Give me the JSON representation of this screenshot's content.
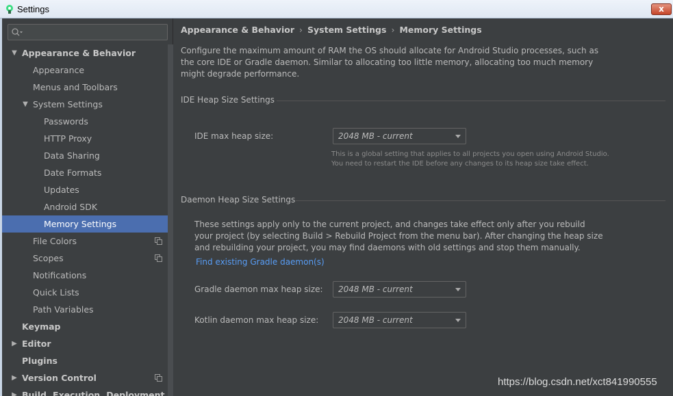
{
  "window": {
    "title": "Settings",
    "close_glyph": "x"
  },
  "search": {
    "placeholder": "",
    "icon": "search-icon"
  },
  "sidebar": {
    "items": [
      {
        "label": "Appearance & Behavior",
        "arrow": "▼"
      },
      {
        "label": "Appearance"
      },
      {
        "label": "Menus and Toolbars"
      },
      {
        "label": "System Settings",
        "arrow": "▼"
      },
      {
        "label": "Passwords"
      },
      {
        "label": "HTTP Proxy"
      },
      {
        "label": "Data Sharing"
      },
      {
        "label": "Date Formats"
      },
      {
        "label": "Updates"
      },
      {
        "label": "Android SDK"
      },
      {
        "label": "Memory Settings",
        "selected": true
      },
      {
        "label": "File Colors",
        "project_icon": true
      },
      {
        "label": "Scopes",
        "project_icon": true
      },
      {
        "label": "Notifications"
      },
      {
        "label": "Quick Lists"
      },
      {
        "label": "Path Variables"
      },
      {
        "label": "Keymap"
      },
      {
        "label": "Editor",
        "arrow": "▶"
      },
      {
        "label": "Plugins"
      },
      {
        "label": "Version Control",
        "arrow": "▶",
        "project_icon": true
      },
      {
        "label": "Build, Execution, Deployment",
        "arrow": "▶"
      }
    ]
  },
  "breadcrumb": {
    "items": [
      "Appearance & Behavior",
      "System Settings",
      "Memory Settings"
    ],
    "separator": "›"
  },
  "description": "Configure the maximum amount of RAM the OS should allocate for Android Studio processes, such as the core IDE or Gradle daemon. Similar to allocating too little memory, allocating too much memory might degrade performance.",
  "ide_section": {
    "title": "IDE Heap Size Settings",
    "label": "IDE max heap size:",
    "value": "2048 MB - current",
    "note_line1": "This is a global setting that applies to all projects you open using Android Studio.",
    "note_line2": "You need to restart the IDE before any changes to its heap size take effect."
  },
  "daemon_section": {
    "title": "Daemon Heap Size Settings",
    "description": "These settings apply only to the current project, and changes take effect only after you rebuild your project (by selecting Build > Rebuild Project from the menu bar). After changing the heap size and rebuilding your project, you may find daemons with old settings and stop them manually.",
    "link": "Find existing Gradle daemon(s)",
    "gradle_label": "Gradle daemon max heap size:",
    "gradle_value": "2048 MB - current",
    "kotlin_label": "Kotlin daemon max heap size:",
    "kotlin_value": "2048 MB - current"
  },
  "watermark": "https://blog.csdn.net/xct841990555",
  "colors": {
    "background": "#3c3f41",
    "selection": "#4b6eaf",
    "link": "#589df6",
    "text": "#bbbbbb"
  }
}
